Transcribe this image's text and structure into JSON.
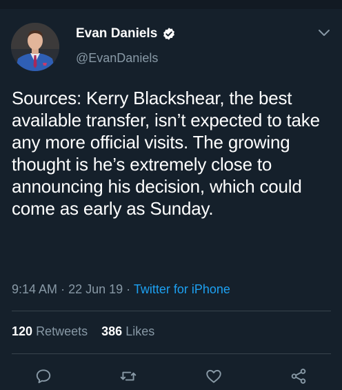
{
  "tweet": {
    "author_name": "Evan Daniels",
    "author_handle": "@EvanDaniels",
    "text": "Sources: Kerry Blackshear, the best available transfer, isn’t expected to take any more official visits. The growing thought is he’s extremely close to announcing his decision, which could come as early as Sunday.",
    "time": "9:14 AM",
    "separator": "·",
    "date": "22 Jun 19",
    "source": "Twitter for iPhone",
    "retweets_count": "120",
    "retweets_label": "Retweets",
    "likes_count": "386",
    "likes_label": "Likes"
  },
  "icons": {
    "verified": "verified-badge-icon",
    "caret": "chevron-down-icon",
    "reply": "reply-icon",
    "retweet": "retweet-icon",
    "like": "heart-icon",
    "share": "share-icon"
  },
  "colors": {
    "background": "#15202b",
    "accent": "#1da1f2",
    "secondary_text": "#8899a6",
    "divider": "#38444d"
  }
}
